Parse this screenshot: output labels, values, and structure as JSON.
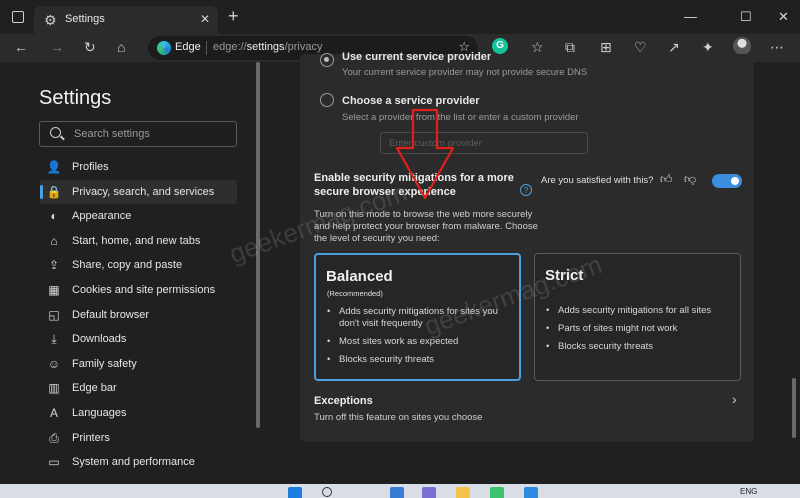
{
  "window": {
    "tab_title": "Settings",
    "tab_close": "✕",
    "new_tab": "+",
    "minimize": "—",
    "maximize": "☐",
    "close": "✕"
  },
  "address_bar": {
    "brand": "Edge",
    "url_prefix": "edge://",
    "url_host": "settings",
    "url_path": "/privacy"
  },
  "toolbar_icons": [
    "back-icon",
    "forward-icon",
    "refresh-icon",
    "home-icon",
    "add-favorite-icon",
    "grammarly-icon",
    "favorites-icon",
    "collections-icon",
    "extension-icon",
    "browser-essentials-icon",
    "share-icon",
    "copilot-icon",
    "profile-avatar",
    "more-icon"
  ],
  "grammarly_letter": "G",
  "sidebar": {
    "title": "Settings",
    "search_placeholder": "Search settings",
    "items": [
      {
        "label": "Profiles",
        "icon": "👤",
        "active": false
      },
      {
        "label": "Privacy, search, and services",
        "icon": "🔒",
        "active": true
      },
      {
        "label": "Appearance",
        "icon": "◐",
        "active": false
      },
      {
        "label": "Start, home, and new tabs",
        "icon": "⌂",
        "active": false
      },
      {
        "label": "Share, copy and paste",
        "icon": "⇪",
        "active": false
      },
      {
        "label": "Cookies and site permissions",
        "icon": "▦",
        "active": false
      },
      {
        "label": "Default browser",
        "icon": "◱",
        "active": false
      },
      {
        "label": "Downloads",
        "icon": "⤓",
        "active": false
      },
      {
        "label": "Family safety",
        "icon": "☺",
        "active": false
      },
      {
        "label": "Edge bar",
        "icon": "▥",
        "active": false
      },
      {
        "label": "Languages",
        "icon": "A",
        "active": false
      },
      {
        "label": "Printers",
        "icon": "⎙",
        "active": false
      },
      {
        "label": "System and performance",
        "icon": "▭",
        "active": false
      }
    ]
  },
  "dns": {
    "current_title": "Use current service provider",
    "current_desc": "Your current service provider may not provide secure DNS",
    "choose_title": "Choose a service provider",
    "choose_desc": "Select a provider from the list or enter a custom provider",
    "input_placeholder": "Enter custom provider"
  },
  "security": {
    "title": "Enable security mitigations for a more secure browser experience",
    "help": "?",
    "description": "Turn on this mode to browse the web more securely and help protect your browser from malware. Choose the level of security you need:",
    "feedback_question": "Are you satisfied with this?",
    "enabled": true,
    "levels": [
      {
        "name": "Balanced",
        "badge": "(Recommended)",
        "selected": true,
        "bullets": [
          "Adds security mitigations for sites you don't visit frequently",
          "Most sites work as expected",
          "Blocks security threats"
        ]
      },
      {
        "name": "Strict",
        "badge": "",
        "selected": false,
        "bullets": [
          "Adds security mitigations for all sites",
          "Parts of sites might not work",
          "Blocks security threats"
        ]
      }
    ]
  },
  "exceptions": {
    "title": "Exceptions",
    "description": "Turn off this feature on sites you choose",
    "chevron": "›"
  },
  "watermark_text": "geekermag.com",
  "taskbar": {
    "language": "ENG"
  },
  "colors": {
    "accent": "#4ca0e0",
    "toggle_on": "#3b8ede",
    "annotation_arrow": "#e0201b",
    "background": "#202020",
    "card": "#2b2b2b"
  }
}
